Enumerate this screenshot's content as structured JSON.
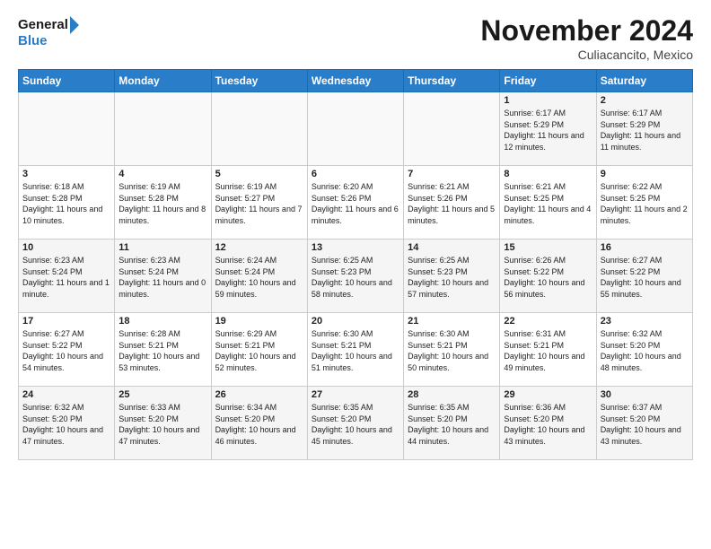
{
  "header": {
    "logo_line1": "General",
    "logo_line2": "Blue",
    "month_title": "November 2024",
    "location": "Culiacancito, Mexico"
  },
  "days_of_week": [
    "Sunday",
    "Monday",
    "Tuesday",
    "Wednesday",
    "Thursday",
    "Friday",
    "Saturday"
  ],
  "weeks": [
    [
      {
        "day": "",
        "text": ""
      },
      {
        "day": "",
        "text": ""
      },
      {
        "day": "",
        "text": ""
      },
      {
        "day": "",
        "text": ""
      },
      {
        "day": "",
        "text": ""
      },
      {
        "day": "1",
        "text": "Sunrise: 6:17 AM\nSunset: 5:29 PM\nDaylight: 11 hours and 12 minutes."
      },
      {
        "day": "2",
        "text": "Sunrise: 6:17 AM\nSunset: 5:29 PM\nDaylight: 11 hours and 11 minutes."
      }
    ],
    [
      {
        "day": "3",
        "text": "Sunrise: 6:18 AM\nSunset: 5:28 PM\nDaylight: 11 hours and 10 minutes."
      },
      {
        "day": "4",
        "text": "Sunrise: 6:19 AM\nSunset: 5:28 PM\nDaylight: 11 hours and 8 minutes."
      },
      {
        "day": "5",
        "text": "Sunrise: 6:19 AM\nSunset: 5:27 PM\nDaylight: 11 hours and 7 minutes."
      },
      {
        "day": "6",
        "text": "Sunrise: 6:20 AM\nSunset: 5:26 PM\nDaylight: 11 hours and 6 minutes."
      },
      {
        "day": "7",
        "text": "Sunrise: 6:21 AM\nSunset: 5:26 PM\nDaylight: 11 hours and 5 minutes."
      },
      {
        "day": "8",
        "text": "Sunrise: 6:21 AM\nSunset: 5:25 PM\nDaylight: 11 hours and 4 minutes."
      },
      {
        "day": "9",
        "text": "Sunrise: 6:22 AM\nSunset: 5:25 PM\nDaylight: 11 hours and 2 minutes."
      }
    ],
    [
      {
        "day": "10",
        "text": "Sunrise: 6:23 AM\nSunset: 5:24 PM\nDaylight: 11 hours and 1 minute."
      },
      {
        "day": "11",
        "text": "Sunrise: 6:23 AM\nSunset: 5:24 PM\nDaylight: 11 hours and 0 minutes."
      },
      {
        "day": "12",
        "text": "Sunrise: 6:24 AM\nSunset: 5:24 PM\nDaylight: 10 hours and 59 minutes."
      },
      {
        "day": "13",
        "text": "Sunrise: 6:25 AM\nSunset: 5:23 PM\nDaylight: 10 hours and 58 minutes."
      },
      {
        "day": "14",
        "text": "Sunrise: 6:25 AM\nSunset: 5:23 PM\nDaylight: 10 hours and 57 minutes."
      },
      {
        "day": "15",
        "text": "Sunrise: 6:26 AM\nSunset: 5:22 PM\nDaylight: 10 hours and 56 minutes."
      },
      {
        "day": "16",
        "text": "Sunrise: 6:27 AM\nSunset: 5:22 PM\nDaylight: 10 hours and 55 minutes."
      }
    ],
    [
      {
        "day": "17",
        "text": "Sunrise: 6:27 AM\nSunset: 5:22 PM\nDaylight: 10 hours and 54 minutes."
      },
      {
        "day": "18",
        "text": "Sunrise: 6:28 AM\nSunset: 5:21 PM\nDaylight: 10 hours and 53 minutes."
      },
      {
        "day": "19",
        "text": "Sunrise: 6:29 AM\nSunset: 5:21 PM\nDaylight: 10 hours and 52 minutes."
      },
      {
        "day": "20",
        "text": "Sunrise: 6:30 AM\nSunset: 5:21 PM\nDaylight: 10 hours and 51 minutes."
      },
      {
        "day": "21",
        "text": "Sunrise: 6:30 AM\nSunset: 5:21 PM\nDaylight: 10 hours and 50 minutes."
      },
      {
        "day": "22",
        "text": "Sunrise: 6:31 AM\nSunset: 5:21 PM\nDaylight: 10 hours and 49 minutes."
      },
      {
        "day": "23",
        "text": "Sunrise: 6:32 AM\nSunset: 5:20 PM\nDaylight: 10 hours and 48 minutes."
      }
    ],
    [
      {
        "day": "24",
        "text": "Sunrise: 6:32 AM\nSunset: 5:20 PM\nDaylight: 10 hours and 47 minutes."
      },
      {
        "day": "25",
        "text": "Sunrise: 6:33 AM\nSunset: 5:20 PM\nDaylight: 10 hours and 47 minutes."
      },
      {
        "day": "26",
        "text": "Sunrise: 6:34 AM\nSunset: 5:20 PM\nDaylight: 10 hours and 46 minutes."
      },
      {
        "day": "27",
        "text": "Sunrise: 6:35 AM\nSunset: 5:20 PM\nDaylight: 10 hours and 45 minutes."
      },
      {
        "day": "28",
        "text": "Sunrise: 6:35 AM\nSunset: 5:20 PM\nDaylight: 10 hours and 44 minutes."
      },
      {
        "day": "29",
        "text": "Sunrise: 6:36 AM\nSunset: 5:20 PM\nDaylight: 10 hours and 43 minutes."
      },
      {
        "day": "30",
        "text": "Sunrise: 6:37 AM\nSunset: 5:20 PM\nDaylight: 10 hours and 43 minutes."
      }
    ]
  ]
}
